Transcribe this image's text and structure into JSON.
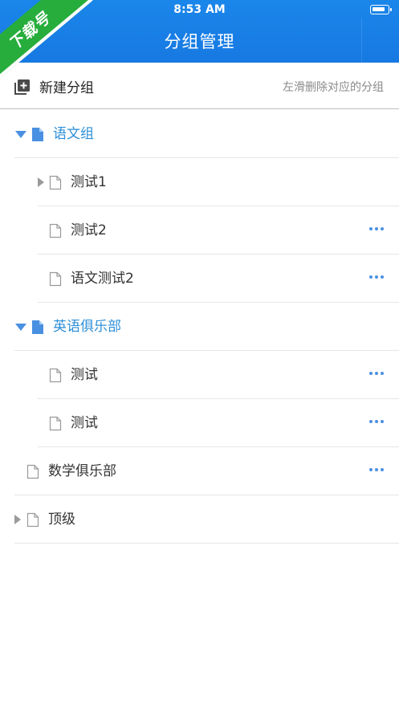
{
  "status_bar": {
    "time": "8:53 AM"
  },
  "header": {
    "title": "分组管理"
  },
  "watermark": {
    "text": "下载号"
  },
  "toolbar": {
    "new_group_label": "新建分组",
    "hint": "左滑删除对应的分组"
  },
  "groups": [
    {
      "label": "语文组",
      "level": 0,
      "expanded": true,
      "has_children": true,
      "more": false
    },
    {
      "label": "测试1",
      "level": 1,
      "expanded": false,
      "has_children": true,
      "more": false
    },
    {
      "label": "测试2",
      "level": 1,
      "expanded": false,
      "has_children": false,
      "more": true
    },
    {
      "label": "语文测试2",
      "level": 1,
      "expanded": false,
      "has_children": false,
      "more": true
    },
    {
      "label": "英语俱乐部",
      "level": 0,
      "expanded": true,
      "has_children": true,
      "more": false
    },
    {
      "label": "测试",
      "level": 1,
      "expanded": false,
      "has_children": false,
      "more": true
    },
    {
      "label": "测试",
      "level": 1,
      "expanded": false,
      "has_children": false,
      "more": true
    },
    {
      "label": "数学俱乐部",
      "level": 0,
      "expanded": false,
      "has_children": false,
      "more": true
    },
    {
      "label": "顶级",
      "level": 0,
      "expanded": false,
      "has_children": true,
      "more": false
    }
  ],
  "colors": {
    "header": "#1779e2",
    "accent": "#2c8fd8",
    "badge": "#27ad3c"
  },
  "icons": [
    "plus-square-icon",
    "expand-down-icon",
    "expand-right-icon",
    "file-icon",
    "more-icon",
    "battery-icon"
  ]
}
